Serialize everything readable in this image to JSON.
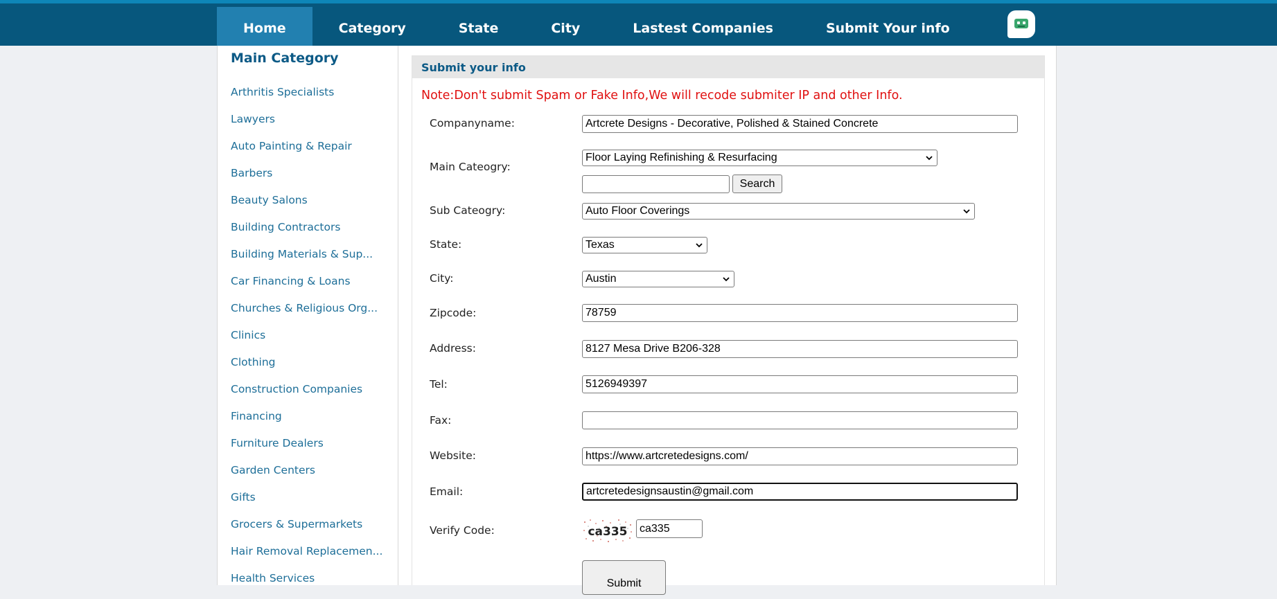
{
  "nav": {
    "items": [
      "Home",
      "Category",
      "State",
      "City",
      "Lastest Companies",
      "Submit Your info"
    ],
    "active": "Home"
  },
  "sidebar": {
    "title": "Main Category",
    "items": [
      "Arthritis Specialists",
      "Lawyers",
      "Auto Painting & Repair",
      "Barbers",
      "Beauty Salons",
      "Building Contractors",
      "Building Materials & Sup...",
      "Car Financing & Loans",
      "Churches & Religious Org...",
      "Clinics",
      "Clothing",
      "Construction Companies",
      "Financing",
      "Furniture Dealers",
      "Garden Centers",
      "Gifts",
      "Grocers & Supermarkets",
      "Hair Removal Replacemen...",
      "Health Services"
    ]
  },
  "form": {
    "heading": "Submit your info",
    "note": "Note:Don't submit Spam or Fake Info,We will recode submiter IP and other Info.",
    "companyname_label": "Companyname:",
    "companyname_value": "Artcrete Designs - Decorative, Polished & Stained Concrete",
    "main_category_label": "Main Cateogry:",
    "main_category_value": "Floor Laying Refinishing & Resurfacing",
    "category_search_value": "",
    "search_label": "Search",
    "sub_category_label": "Sub Cateogry:",
    "sub_category_value": "Auto Floor Coverings",
    "state_label": "State:",
    "state_value": "Texas",
    "city_label": "City:",
    "city_value": "Austin",
    "zipcode_label": "Zipcode:",
    "zipcode_value": "78759",
    "address_label": "Address:",
    "address_value": "8127 Mesa Drive B206-328",
    "tel_label": "Tel:",
    "tel_value": "5126949397",
    "fax_label": "Fax:",
    "fax_value": "",
    "website_label": "Website:",
    "website_value": "https://www.artcretedesigns.com/",
    "email_label": "Email:",
    "email_value": "artcretedesignsaustin@gmail.com",
    "verify_label": "Verify Code:",
    "captcha_text": "ca335",
    "verify_value": "ca335",
    "submit_label": "Submit"
  },
  "colors": {
    "nav_bg": "#07577d",
    "nav_active": "#2280b0",
    "link": "#1d6e98",
    "note": "#e01010"
  },
  "icons": {
    "bot": "robot-face-icon",
    "select": "chevron-down-icon"
  }
}
